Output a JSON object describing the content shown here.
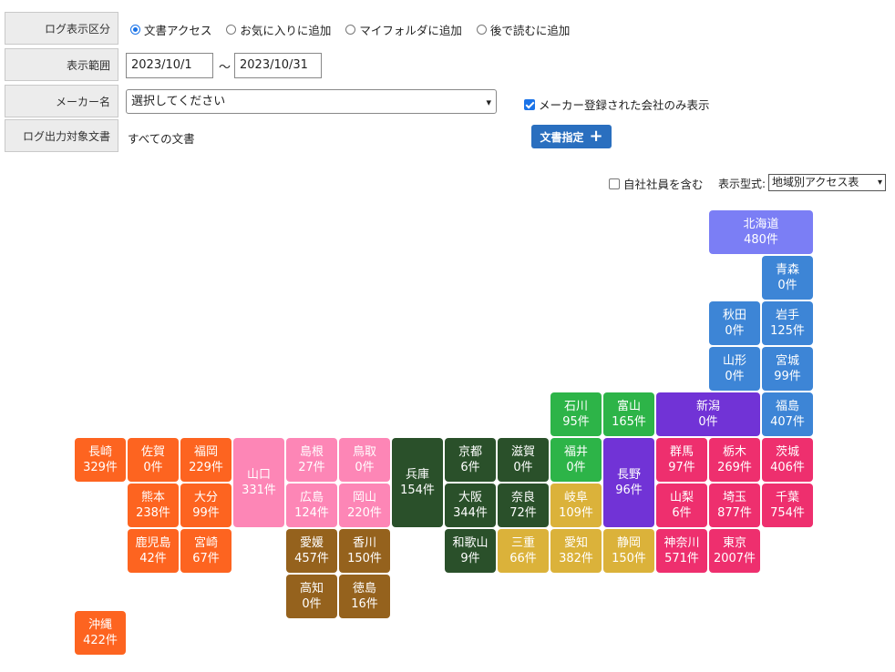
{
  "form": {
    "log_type_label": "ログ表示区分",
    "log_types": [
      {
        "label": "文書アクセス",
        "checked": true
      },
      {
        "label": "お気に入りに追加",
        "checked": false
      },
      {
        "label": "マイフォルダに追加",
        "checked": false
      },
      {
        "label": "後で読むに追加",
        "checked": false
      }
    ],
    "range_label": "表示範囲",
    "date_from": "2023/10/1",
    "date_sep": "〜",
    "date_to": "2023/10/31",
    "maker_label": "メーカー名",
    "maker_select": "選択してください",
    "maker_only_label": "メーカー登録された会社のみ表示",
    "target_label": "ログ出力対象文書",
    "target_value": "すべての文書",
    "doc_button": "文書指定",
    "include_own_label": "自社社員を含む",
    "display_type_label": "表示型式:",
    "display_type_value": "地域別アクセス表"
  },
  "unit": "件",
  "colors": {
    "hokkaido": "#7b7ef5",
    "tohoku": "#3d85d6",
    "kanto": "#ee2f6e",
    "chubu_green": "#2db448",
    "chubu_purple": "#7133d6",
    "chubu_gold": "#dbb23a",
    "kinki": "#2a502a",
    "chugoku_pink": "#fd86b6",
    "shikoku": "#95621d",
    "kyushu": "#fd6420"
  },
  "prefectures": [
    {
      "name": "北海道",
      "count": 480,
      "region": "hokkaido"
    },
    {
      "name": "青森",
      "count": 0,
      "region": "tohoku"
    },
    {
      "name": "秋田",
      "count": 0,
      "region": "tohoku"
    },
    {
      "name": "岩手",
      "count": 125,
      "region": "tohoku"
    },
    {
      "name": "山形",
      "count": 0,
      "region": "tohoku"
    },
    {
      "name": "宮城",
      "count": 99,
      "region": "tohoku"
    },
    {
      "name": "福島",
      "count": 407,
      "region": "tohoku"
    },
    {
      "name": "石川",
      "count": 95,
      "region": "chubu_green"
    },
    {
      "name": "富山",
      "count": 165,
      "region": "chubu_green"
    },
    {
      "name": "新潟",
      "count": 0,
      "region": "chubu_purple"
    },
    {
      "name": "福井",
      "count": 0,
      "region": "chubu_green"
    },
    {
      "name": "長野",
      "count": 96,
      "region": "chubu_purple"
    },
    {
      "name": "岐阜",
      "count": 109,
      "region": "chubu_gold"
    },
    {
      "name": "愛知",
      "count": 382,
      "region": "chubu_gold"
    },
    {
      "name": "静岡",
      "count": 150,
      "region": "chubu_gold"
    },
    {
      "name": "三重",
      "count": 66,
      "region": "chubu_gold"
    },
    {
      "name": "群馬",
      "count": 97,
      "region": "kanto"
    },
    {
      "name": "栃木",
      "count": 269,
      "region": "kanto"
    },
    {
      "name": "茨城",
      "count": 406,
      "region": "kanto"
    },
    {
      "name": "山梨",
      "count": 6,
      "region": "kanto"
    },
    {
      "name": "埼玉",
      "count": 877,
      "region": "kanto"
    },
    {
      "name": "千葉",
      "count": 754,
      "region": "kanto"
    },
    {
      "name": "神奈川",
      "count": 571,
      "region": "kanto"
    },
    {
      "name": "東京",
      "count": 2007,
      "region": "kanto"
    },
    {
      "name": "京都",
      "count": 6,
      "region": "kinki"
    },
    {
      "name": "滋賀",
      "count": 0,
      "region": "kinki"
    },
    {
      "name": "大阪",
      "count": 344,
      "region": "kinki"
    },
    {
      "name": "奈良",
      "count": 72,
      "region": "kinki"
    },
    {
      "name": "和歌山",
      "count": 9,
      "region": "kinki"
    },
    {
      "name": "兵庫",
      "count": 154,
      "region": "kinki"
    },
    {
      "name": "山口",
      "count": 331,
      "region": "chugoku_pink"
    },
    {
      "name": "島根",
      "count": 27,
      "region": "chugoku_pink"
    },
    {
      "name": "鳥取",
      "count": 0,
      "region": "chugoku_pink"
    },
    {
      "name": "広島",
      "count": 124,
      "region": "chugoku_pink"
    },
    {
      "name": "岡山",
      "count": 220,
      "region": "chugoku_pink"
    },
    {
      "name": "愛媛",
      "count": 457,
      "region": "shikoku"
    },
    {
      "name": "香川",
      "count": 150,
      "region": "shikoku"
    },
    {
      "name": "高知",
      "count": 0,
      "region": "shikoku"
    },
    {
      "name": "徳島",
      "count": 16,
      "region": "shikoku"
    },
    {
      "name": "長崎",
      "count": 329,
      "region": "kyushu"
    },
    {
      "name": "佐賀",
      "count": 0,
      "region": "kyushu"
    },
    {
      "name": "福岡",
      "count": 229,
      "region": "kyushu"
    },
    {
      "name": "熊本",
      "count": 238,
      "region": "kyushu"
    },
    {
      "name": "大分",
      "count": 99,
      "region": "kyushu"
    },
    {
      "name": "鹿児島",
      "count": 42,
      "region": "kyushu"
    },
    {
      "name": "宮崎",
      "count": 67,
      "region": "kyushu"
    },
    {
      "name": "沖縄",
      "count": 422,
      "region": "kyushu"
    }
  ]
}
